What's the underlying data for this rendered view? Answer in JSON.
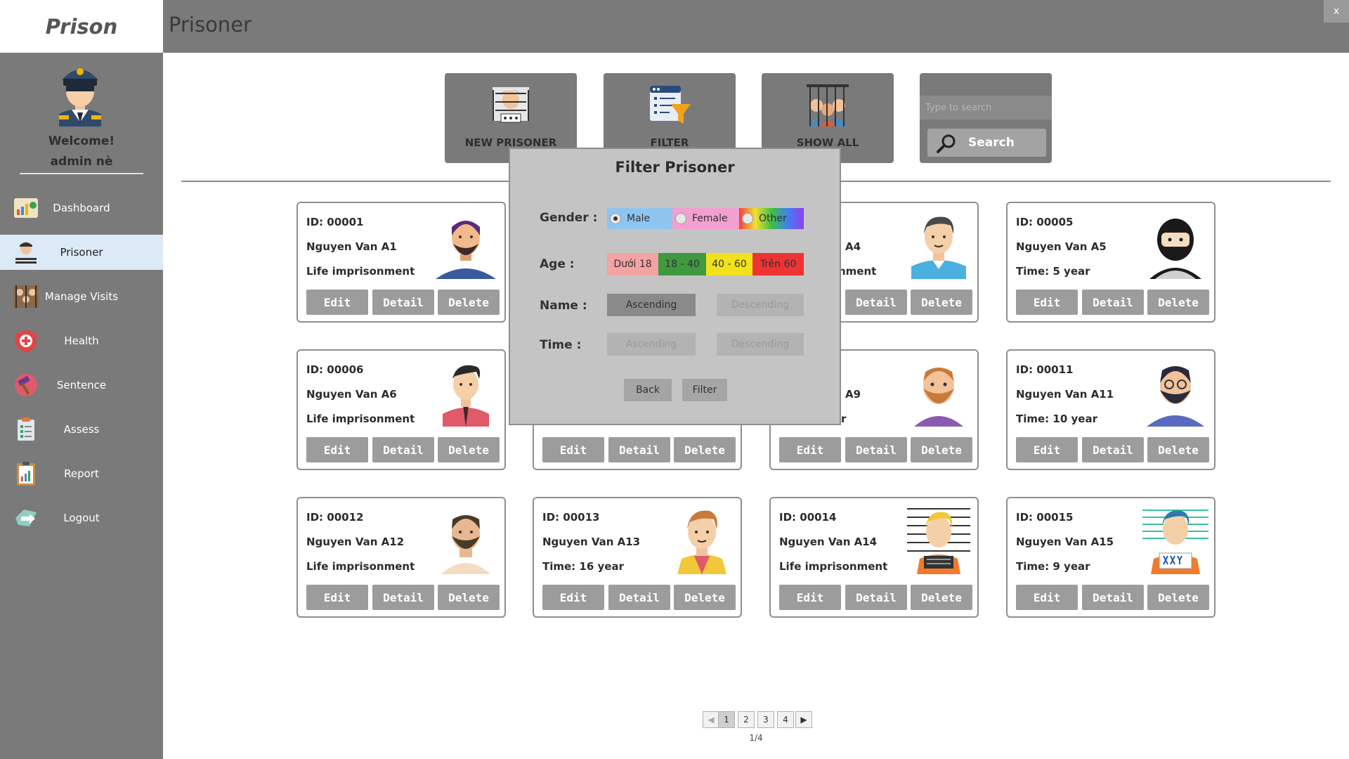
{
  "app": {
    "brand": "Prison",
    "page_title": "Prisoner",
    "close_label": "x"
  },
  "sidebar": {
    "welcome_line1": "Welcome!",
    "welcome_line2": "admin nè",
    "items": [
      {
        "label": "Dashboard",
        "icon": "dashboard-icon"
      },
      {
        "label": "Prisoner",
        "icon": "prisoner-icon",
        "active": true
      },
      {
        "label": "Manage Visits",
        "icon": "visits-icon"
      },
      {
        "label": "Health",
        "icon": "health-icon"
      },
      {
        "label": "Sentence",
        "icon": "sentence-icon"
      },
      {
        "label": "Assess",
        "icon": "assess-icon"
      },
      {
        "label": "Report",
        "icon": "report-icon"
      },
      {
        "label": "Logout",
        "icon": "logout-icon"
      }
    ]
  },
  "toolbar": {
    "new_prisoner": "NEW PRISONER",
    "filter": "FILTER",
    "show_all": "SHOW ALL",
    "search_placeholder": "Type to search",
    "search_label": "Search"
  },
  "card_buttons": {
    "edit": "Edit",
    "detail": "Detail",
    "delete": "Delete"
  },
  "cards": [
    {
      "id": "ID: 00001",
      "name": "Nguyen Van A1",
      "sentence": "Life imprisonment"
    },
    {
      "id": "",
      "name": "A4",
      "sentence": "nment"
    },
    {
      "id": "ID: 00005",
      "name": "Nguyen Van A5",
      "sentence": "Time: 5 year"
    },
    {
      "id": "ID: 00006",
      "name": "Nguyen Van A6",
      "sentence": "Life imprisonment"
    },
    {
      "id": "",
      "name": "A9",
      "sentence": "r"
    },
    {
      "id": "ID: 00011",
      "name": "Nguyen Van A11",
      "sentence": "Time: 10 year"
    },
    {
      "id": "ID: 00012",
      "name": "Nguyen Van A12",
      "sentence": "Life imprisonment"
    },
    {
      "id": "ID: 00013",
      "name": "Nguyen Van A13",
      "sentence": "Time: 16 year"
    },
    {
      "id": "ID: 00014",
      "name": "Nguyen Van A14",
      "sentence": "Life imprisonment"
    },
    {
      "id": "ID: 00015",
      "name": "Nguyen Van A15",
      "sentence": "Time: 9 year"
    }
  ],
  "filter_modal": {
    "title": "Filter Prisoner",
    "gender_label": "Gender :",
    "gender_options": [
      "Male",
      "Female",
      "Other"
    ],
    "gender_selected": "Male",
    "age_label": "Age :",
    "age_options": [
      "Dưới 18",
      "18 - 40",
      "40 - 60",
      "Trên 60"
    ],
    "age_colors": [
      "#f4a3a3",
      "#3f9a3f",
      "#f2e21c",
      "#ee3333"
    ],
    "name_label": "Name :",
    "time_label": "Time :",
    "ascending": "Ascending",
    "descending": "Descending",
    "back": "Back",
    "filter": "Filter"
  },
  "pagination": {
    "pages": [
      "1",
      "2",
      "3",
      "4"
    ],
    "current": "1",
    "status": "1/4",
    "prev": "◀",
    "next": "▶"
  }
}
